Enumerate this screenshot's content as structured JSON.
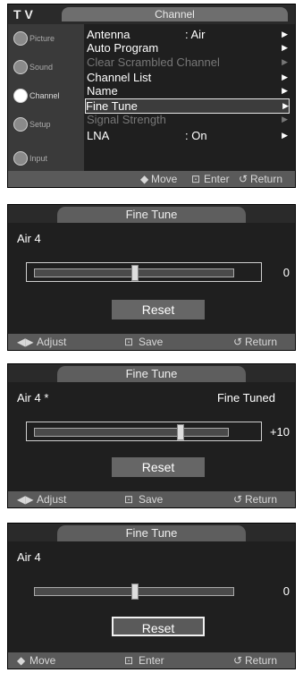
{
  "screen1": {
    "title_left": "T V",
    "title_tab": "Channel",
    "sidebar": [
      "Picture",
      "Sound",
      "Channel",
      "Setup",
      "Input"
    ],
    "menu": [
      {
        "name": "Antenna",
        "value": ": Air",
        "dim": false
      },
      {
        "name": "Auto Program",
        "value": "",
        "dim": false
      },
      {
        "name": "Clear Scrambled Channel",
        "value": "",
        "dim": true
      },
      {
        "name": "Channel List",
        "value": "",
        "dim": false
      },
      {
        "name": "Name",
        "value": "",
        "dim": false
      },
      {
        "name": "Fine Tune",
        "value": "",
        "dim": false
      },
      {
        "name": "Signal Strength",
        "value": "",
        "dim": true
      },
      {
        "name": "LNA",
        "value": ": On",
        "dim": false
      }
    ],
    "footer": {
      "move": "Move",
      "enter": "Enter",
      "return": "Return"
    }
  },
  "screen2": {
    "title": "Fine Tune",
    "channel": "Air 4",
    "status": "",
    "value_text": "0",
    "slider_fraction": 0.5,
    "reset": "Reset",
    "footer": {
      "adjust": "Adjust",
      "save": "Save",
      "return": "Return"
    }
  },
  "screen3": {
    "title": "Fine Tune",
    "channel": "Air 4 *",
    "status": "Fine Tuned",
    "value_text": "+10",
    "slider_fraction": 0.75,
    "reset": "Reset",
    "footer": {
      "adjust": "Adjust",
      "save": "Save",
      "return": "Return"
    }
  },
  "screen4": {
    "title": "Fine Tune",
    "channel": "Air 4",
    "status": "",
    "value_text": "0",
    "slider_fraction": 0.5,
    "reset": "Reset",
    "footer": {
      "move": "Move",
      "enter": "Enter",
      "return": "Return"
    }
  }
}
